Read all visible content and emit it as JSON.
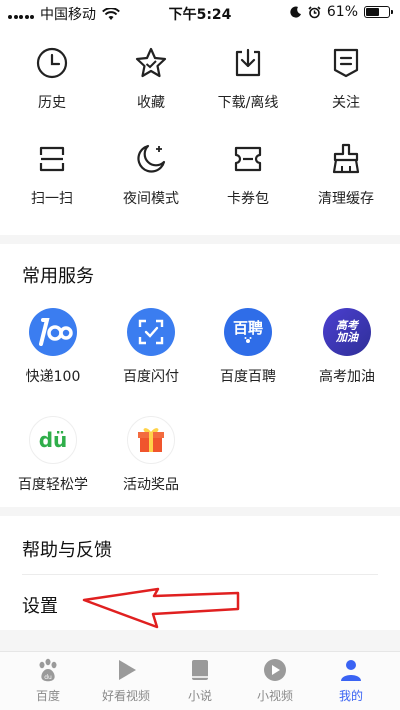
{
  "status_bar": {
    "carrier": "中国移动",
    "time": "下午5:24",
    "battery_text": "61%",
    "battery_level": 0.61
  },
  "quick_actions": [
    {
      "label": "历史",
      "icon": "clock-icon"
    },
    {
      "label": "收藏",
      "icon": "star-icon"
    },
    {
      "label": "下载/离线",
      "icon": "download-icon"
    },
    {
      "label": "关注",
      "icon": "follow-list-icon"
    },
    {
      "label": "扫一扫",
      "icon": "scan-icon"
    },
    {
      "label": "夜间模式",
      "icon": "moon-icon"
    },
    {
      "label": "卡券包",
      "icon": "coupon-icon"
    },
    {
      "label": "清理缓存",
      "icon": "broom-icon"
    }
  ],
  "services": {
    "title": "常用服务",
    "items": [
      {
        "label": "快递100",
        "icon": "kuaidi100-icon",
        "color": "#3b7df0"
      },
      {
        "label": "百度闪付",
        "icon": "scan-pay-icon",
        "color": "#3b7df0"
      },
      {
        "label": "百度百聘",
        "icon": "baipin-icon",
        "icon_text": "百聘",
        "color": "#2f6de8"
      },
      {
        "label": "高考加油",
        "icon": "gaokao-icon",
        "icon_text": "高考加油",
        "color": "#3a3ab8"
      },
      {
        "label": "百度轻松学",
        "icon": "du-learn-icon",
        "icon_text": "dü",
        "color": "#2fae4a"
      },
      {
        "label": "活动奖品",
        "icon": "gift-icon",
        "color": "#f0552d"
      }
    ]
  },
  "menu": {
    "help": "帮助与反馈",
    "settings": "设置"
  },
  "tab_bar": {
    "tabs": [
      {
        "label": "百度",
        "icon": "baidu-paw-icon",
        "active": false
      },
      {
        "label": "好看视频",
        "icon": "play-icon",
        "active": false
      },
      {
        "label": "小说",
        "icon": "book-icon",
        "active": false
      },
      {
        "label": "小视频",
        "icon": "small-video-icon",
        "active": false
      },
      {
        "label": "我的",
        "icon": "profile-icon",
        "active": true
      }
    ]
  },
  "colors": {
    "accent": "#3a63f3",
    "annotation_arrow": "#e02020"
  }
}
